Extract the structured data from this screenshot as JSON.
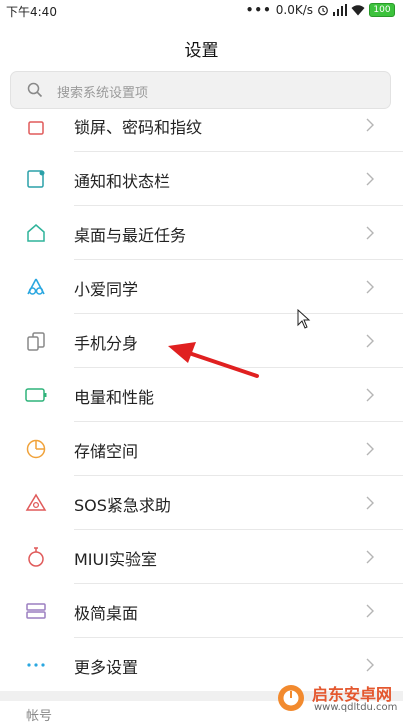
{
  "status_bar": {
    "time": "下午4:40",
    "dots": "•••",
    "network_speed": "0.0K/s",
    "battery": "100"
  },
  "header": {
    "title": "设置"
  },
  "search": {
    "placeholder": "搜索系统设置项"
  },
  "menu": {
    "items": [
      {
        "label": "锁屏、密码和指纹",
        "icon": "lock-icon",
        "color": "#e05a5a"
      },
      {
        "label": "通知和状态栏",
        "icon": "notification-icon",
        "color": "#2aa0a8"
      },
      {
        "label": "桌面与最近任务",
        "icon": "home-icon",
        "color": "#2fb39a"
      },
      {
        "label": "小爱同学",
        "icon": "xiaoai-icon",
        "color": "#2aa7e0"
      },
      {
        "label": "手机分身",
        "icon": "second-space-icon",
        "color": "#888888"
      },
      {
        "label": "电量和性能",
        "icon": "battery-icon",
        "color": "#2fb37a"
      },
      {
        "label": "存储空间",
        "icon": "storage-icon",
        "color": "#f0a23a"
      },
      {
        "label": "SOS紧急求助",
        "icon": "sos-icon",
        "color": "#e05a5a"
      },
      {
        "label": "MIUI实验室",
        "icon": "lab-icon",
        "color": "#e05a5a"
      },
      {
        "label": "极简桌面",
        "icon": "minimal-desktop-icon",
        "color": "#9b7fc0"
      },
      {
        "label": "更多设置",
        "icon": "more-icon",
        "color": "#2aa7e0"
      }
    ]
  },
  "section_next": {
    "label": "帐号"
  },
  "watermark": {
    "title": "启东安卓网",
    "url": "www.qdltdu.com"
  }
}
